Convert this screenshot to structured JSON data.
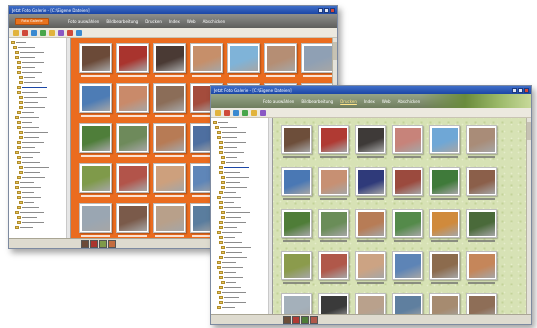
{
  "back_window": {
    "title": "Jetzt Foto Galerie - [C:\\Eigene Dateien]",
    "brand_label": "Foto Galerie",
    "menu": [
      {
        "label": "Foto auswählen",
        "active": false
      },
      {
        "label": "Bildbearbeitung",
        "active": false
      },
      {
        "label": "Drucken",
        "active": false
      },
      {
        "label": "Index",
        "active": false
      },
      {
        "label": "Web",
        "active": false
      },
      {
        "label": "Abschicken",
        "active": false
      }
    ],
    "tools": [
      "#e1b33c",
      "#cf4a3a",
      "#3a8ad0",
      "#48a64a",
      "#e1b33c",
      "#8a58c4",
      "#cf4a3a",
      "#3a8ad0"
    ],
    "theme_color": "#ea6c1f",
    "photos": [
      [
        "#6b4a38",
        "#a9342e",
        "#4a3a34",
        "#c68f6a",
        "#7fb3d8",
        "#b58e74",
        "#8fa0b4"
      ],
      [
        "#4d7cb5",
        "#c98a6a",
        "#8b6d58",
        "#a44c3c",
        "#7d9dc4",
        "#5a6f3e",
        "#9a7a66"
      ],
      [
        "#4f7e3a",
        "#6e8a5b",
        "#b77b55",
        "#4e6fa0",
        "#c36c3f",
        "#3d5a2f",
        "#a37b62"
      ],
      [
        "#7f9a4a",
        "#b2544a",
        "#cda07d",
        "#5f86b8",
        "#8a6a4c",
        "#cf8f5c",
        "#6b9e5a"
      ],
      [
        "#9aa6b2",
        "#7a5a4a",
        "#b8a08a",
        "#5a7d9e",
        "#a68a6e",
        "#8f6f58",
        "#4b6b8a"
      ]
    ],
    "mini_thumbs": [
      "#6b4a38",
      "#a9342e",
      "#7f9a4a",
      "#c36c3f"
    ]
  },
  "front_window": {
    "title": "Jetzt Foto Galerie - [C:\\Eigene Dateien]",
    "menu": [
      {
        "label": "Foto auswählen",
        "active": false
      },
      {
        "label": "Bildbearbeitung",
        "active": false
      },
      {
        "label": "Drucken",
        "active": true
      },
      {
        "label": "Index",
        "active": false
      },
      {
        "label": "Web",
        "active": false
      },
      {
        "label": "Abschicken",
        "active": false
      }
    ],
    "tools": [
      "#e1b33c",
      "#cf4a3a",
      "#3a8ad0",
      "#48a64a",
      "#e1b33c",
      "#8a58c4"
    ],
    "theme_color": "#d7e2b5",
    "photos": [
      [
        "#6d4e3a",
        "#b03a33",
        "#3e3a38",
        "#c7837a",
        "#6fa7d6",
        "#a98c78"
      ],
      [
        "#4a78b4",
        "#c79073",
        "#2f3a7a",
        "#9b4a3e",
        "#3f7a3a",
        "#8b5f4a"
      ],
      [
        "#4f7d38",
        "#6a8d58",
        "#b77c56",
        "#548a4a",
        "#d08a3c",
        "#4a6a3a"
      ],
      [
        "#8b9b4c",
        "#b0584a",
        "#cca383",
        "#5d84b6",
        "#8c6b4d",
        "#c5865a"
      ],
      [
        "#a4b0ba",
        "#3a3a3a",
        "#b9a18c",
        "#5f7f9f",
        "#a68b70",
        "#8e6e57"
      ]
    ],
    "mini_thumbs": [
      "#6d4e3a",
      "#b03a33",
      "#4f7d38",
      "#b0584a"
    ]
  }
}
